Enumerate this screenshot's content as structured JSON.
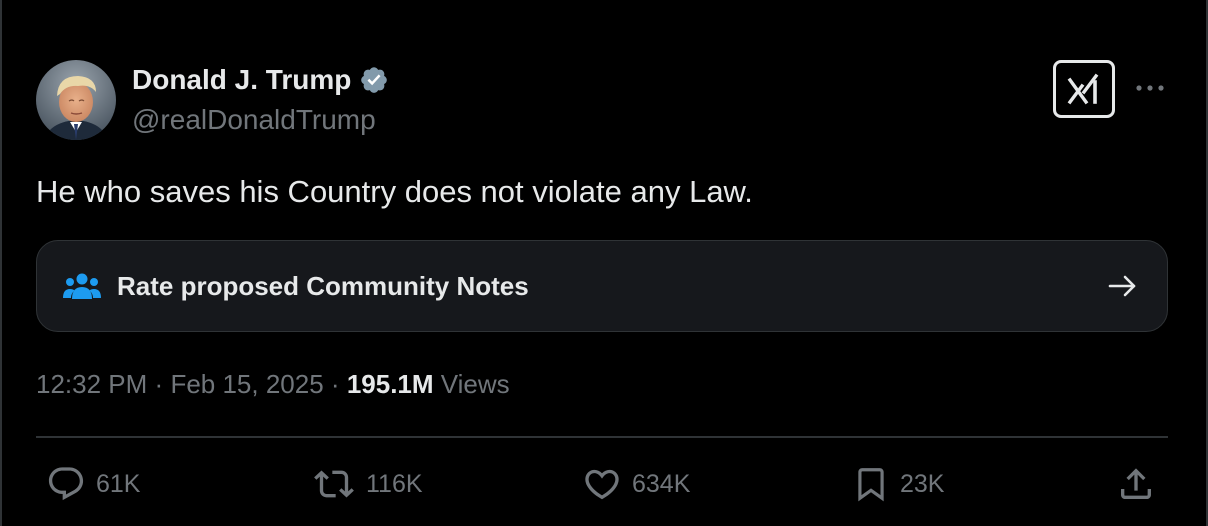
{
  "author": {
    "display_name": "Donald J. Trump",
    "handle": "@realDonaldTrump",
    "verified_badge_icon": "verified-badge-icon"
  },
  "tweet": {
    "text": "He who saves his Country does not violate any Law."
  },
  "community_notes": {
    "label": "Rate proposed Community Notes",
    "icon": "community-people-icon",
    "arrow_icon": "arrow-right-icon"
  },
  "meta": {
    "time": "12:32 PM",
    "separator": "·",
    "date": "Feb 15, 2025",
    "views_count": "195.1M",
    "views_label": "Views"
  },
  "actions": {
    "replies": "61K",
    "reposts": "116K",
    "likes": "634K",
    "bookmarks": "23K"
  },
  "colors": {
    "background": "#000000",
    "text_primary": "#e7e9ea",
    "text_secondary": "#71767b",
    "accent": "#1d9bf0",
    "border": "#2f3336"
  }
}
